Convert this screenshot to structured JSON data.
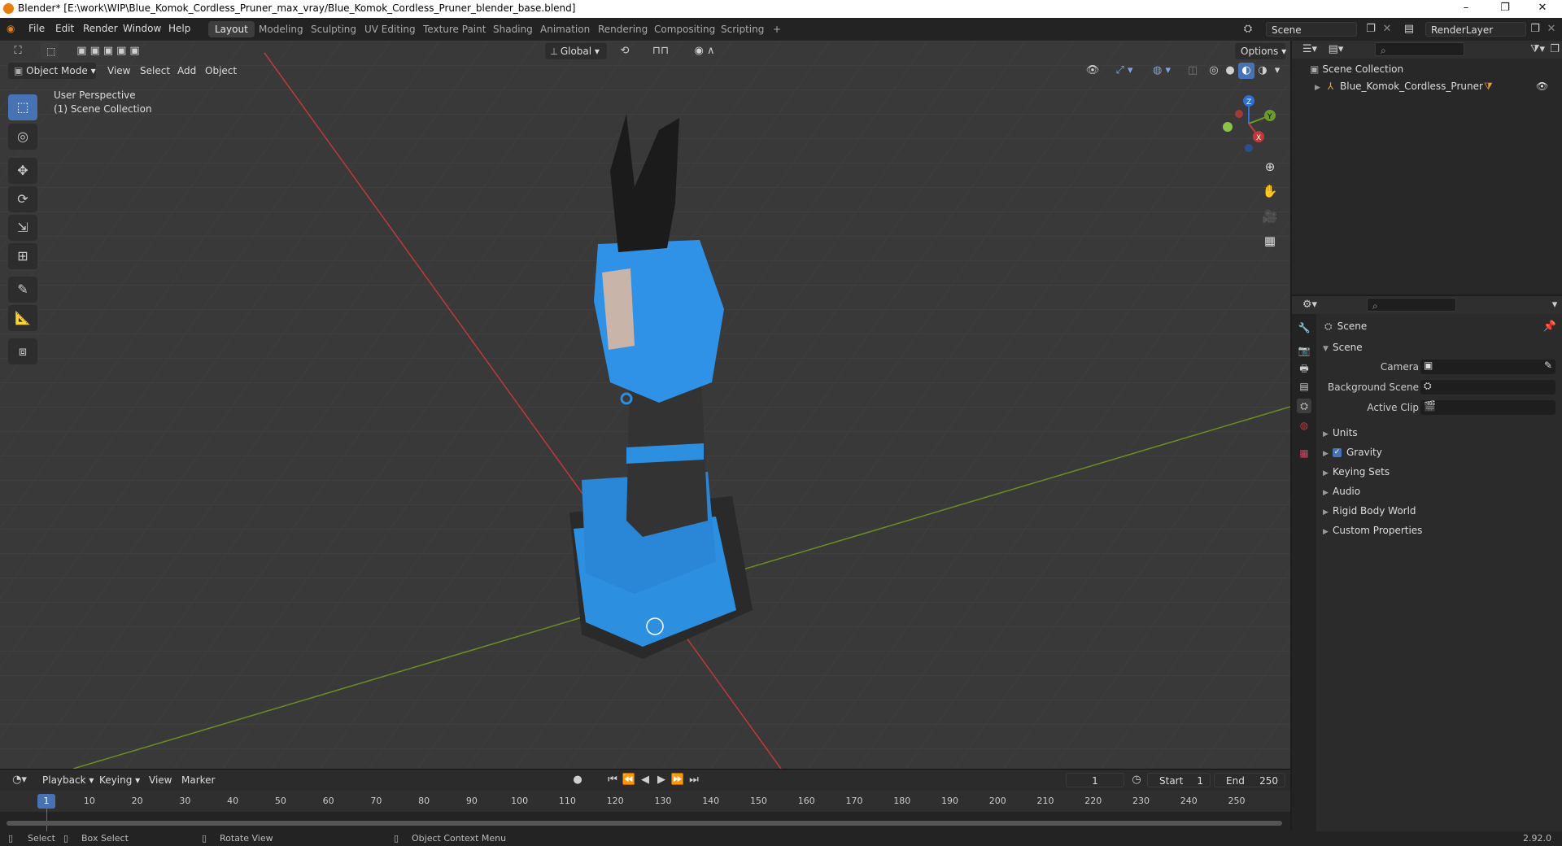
{
  "window": {
    "title": "Blender* [E:\\work\\WIP\\Blue_Komok_Cordless_Pruner_max_vray/Blue_Komok_Cordless_Pruner_blender_base.blend]",
    "controls": [
      "–",
      "❐",
      "✕"
    ]
  },
  "menubar": {
    "items": [
      "File",
      "Edit",
      "Render",
      "Window",
      "Help"
    ],
    "workspaces": [
      "Layout",
      "Modeling",
      "Sculpting",
      "UV Editing",
      "Texture Paint",
      "Shading",
      "Animation",
      "Rendering",
      "Compositing",
      "Scripting"
    ],
    "active_workspace": "Layout",
    "add_workspace": "+",
    "scene": "Scene",
    "view_layer": "RenderLayer"
  },
  "viewport": {
    "mode": "Object Mode",
    "menus": [
      "View",
      "Select",
      "Add",
      "Object"
    ],
    "transform_orientation": "Global",
    "options_label": "Options",
    "overlay_text_line1": "User Perspective",
    "overlay_text_line2": "(1) Scene Collection",
    "gizmo_axes": [
      "X",
      "Y",
      "Z"
    ]
  },
  "toolbar": {
    "tools": [
      "select-box",
      "cursor",
      "move",
      "rotate",
      "scale",
      "transform",
      "annotate",
      "measure",
      "add-cube"
    ],
    "active_tool": "select-box"
  },
  "outliner": {
    "root": "Scene Collection",
    "items": [
      {
        "name": "Blue_Komok_Cordless_Pruner"
      }
    ]
  },
  "properties": {
    "context": "Scene",
    "panel_title": "Scene",
    "fields": [
      {
        "label": "Camera"
      },
      {
        "label": "Background Scene"
      },
      {
        "label": "Active Clip"
      }
    ],
    "subpanels": [
      {
        "label": "Units",
        "checkbox": false
      },
      {
        "label": "Gravity",
        "checkbox": true
      },
      {
        "label": "Keying Sets",
        "checkbox": false
      },
      {
        "label": "Audio",
        "checkbox": false
      },
      {
        "label": "Rigid Body World",
        "checkbox": false
      },
      {
        "label": "Custom Properties",
        "checkbox": false
      }
    ]
  },
  "timeline": {
    "menus": [
      "Playback",
      "Keying",
      "View",
      "Marker"
    ],
    "current_frame": "1",
    "start_label": "Start",
    "start": "1",
    "end_label": "End",
    "end": "250",
    "ticks": [
      "1",
      "10",
      "20",
      "30",
      "40",
      "50",
      "60",
      "70",
      "80",
      "90",
      "100",
      "110",
      "120",
      "130",
      "140",
      "150",
      "160",
      "170",
      "180",
      "190",
      "200",
      "210",
      "220",
      "230",
      "240",
      "250"
    ]
  },
  "statusbar": {
    "select": "Select",
    "box_select": "Box Select",
    "rotate_view": "Rotate View",
    "context_menu": "Object Context Menu",
    "version": "2.92.0"
  },
  "colors": {
    "accent": "#4772b3",
    "viewport_bg": "#393939",
    "model_blue": "#2d8fe0",
    "x_axis": "#c0393b",
    "y_axis": "#6b8e23"
  }
}
